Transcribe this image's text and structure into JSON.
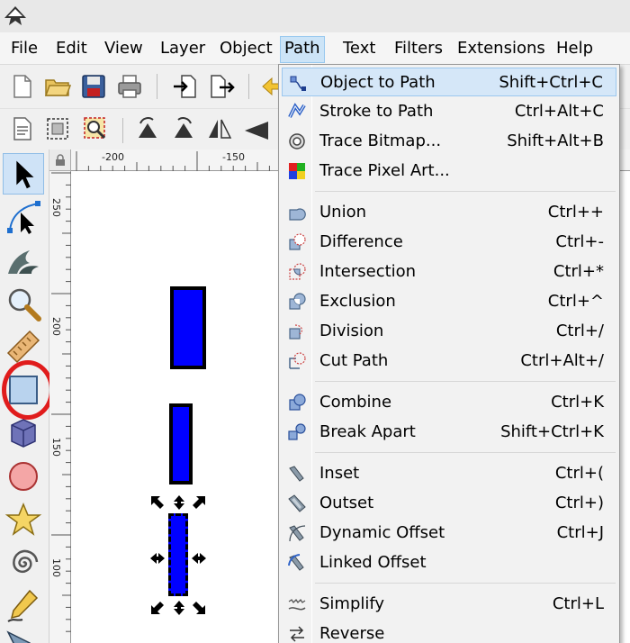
{
  "menubar": {
    "items": [
      "File",
      "Edit",
      "View",
      "Layer",
      "Object",
      "Path",
      "Text",
      "Filters",
      "Extensions",
      "Help"
    ],
    "active": "Path"
  },
  "ruler": {
    "top_labels": [
      "-200",
      "-150"
    ],
    "left_labels": [
      "250",
      "200",
      "150",
      "100"
    ]
  },
  "toolbox": {
    "highlighted_tool": "rectangle-tool"
  },
  "path_menu": {
    "items": [
      {
        "label": "Object to Path",
        "shortcut": "Shift+Ctrl+C",
        "icon": "object-to-path-icon"
      },
      {
        "label": "Stroke to Path",
        "shortcut": "Ctrl+Alt+C",
        "icon": "stroke-to-path-icon"
      },
      {
        "label": "Trace Bitmap...",
        "shortcut": "Shift+Alt+B",
        "icon": "trace-bitmap-icon"
      },
      {
        "label": "Trace Pixel Art...",
        "shortcut": "",
        "icon": "trace-pixel-art-icon"
      },
      {
        "label": "Union",
        "shortcut": "Ctrl++",
        "icon": "union-icon"
      },
      {
        "label": "Difference",
        "shortcut": "Ctrl+-",
        "icon": "difference-icon"
      },
      {
        "label": "Intersection",
        "shortcut": "Ctrl+*",
        "icon": "intersection-icon"
      },
      {
        "label": "Exclusion",
        "shortcut": "Ctrl+^",
        "icon": "exclusion-icon"
      },
      {
        "label": "Division",
        "shortcut": "Ctrl+/",
        "icon": "division-icon"
      },
      {
        "label": "Cut Path",
        "shortcut": "Ctrl+Alt+/",
        "icon": "cut-path-icon"
      },
      {
        "label": "Combine",
        "shortcut": "Ctrl+K",
        "icon": "combine-icon"
      },
      {
        "label": "Break Apart",
        "shortcut": "Shift+Ctrl+K",
        "icon": "break-apart-icon"
      },
      {
        "label": "Inset",
        "shortcut": "Ctrl+(",
        "icon": "inset-icon"
      },
      {
        "label": "Outset",
        "shortcut": "Ctrl+)",
        "icon": "outset-icon"
      },
      {
        "label": "Dynamic Offset",
        "shortcut": "Ctrl+J",
        "icon": "dynamic-offset-icon"
      },
      {
        "label": "Linked Offset",
        "shortcut": "",
        "icon": "linked-offset-icon"
      },
      {
        "label": "Simplify",
        "shortcut": "Ctrl+L",
        "icon": "simplify-icon"
      },
      {
        "label": "Reverse",
        "shortcut": "",
        "icon": "reverse-icon"
      }
    ],
    "highlighted_index": 0
  },
  "colors": {
    "shape_fill": "#0000ff",
    "highlight_circle": "#e01c1c",
    "menu_highlight": "#d5e7f8"
  }
}
